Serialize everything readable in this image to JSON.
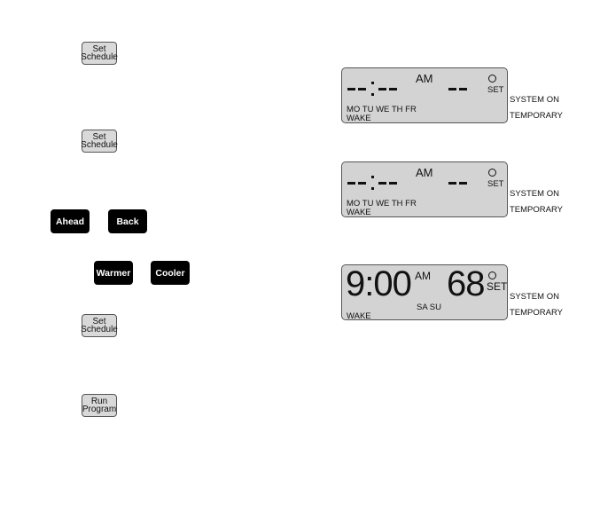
{
  "buttons": {
    "set_schedule": {
      "line1": "Set",
      "line2": "Schedule"
    },
    "run_program": {
      "line1": "Run",
      "line2": "Program"
    },
    "ahead": "Ahead",
    "back": "Back",
    "warmer": "Warmer",
    "cooler": "Cooler"
  },
  "displays": [
    {
      "time": "--:--",
      "ampm": "AM",
      "temp": "--",
      "degree_symbol": "o",
      "set": "SET",
      "days": "MO TU WE TH FR",
      "period": "WAKE",
      "status1": "SYSTEM ON",
      "status2": "TEMPORARY"
    },
    {
      "time": "--:--",
      "ampm": "AM",
      "temp": "--",
      "degree_symbol": "o",
      "set": "SET",
      "days": "MO TU WE TH FR",
      "period": "WAKE",
      "status1": "SYSTEM ON",
      "status2": "TEMPORARY"
    },
    {
      "time": "9:00",
      "ampm": "AM",
      "temp": "68",
      "degree_symbol": "o",
      "set": "SET",
      "days": "SA SU",
      "period": "WAKE",
      "status1": "SYSTEM ON",
      "status2": "TEMPORARY"
    }
  ]
}
